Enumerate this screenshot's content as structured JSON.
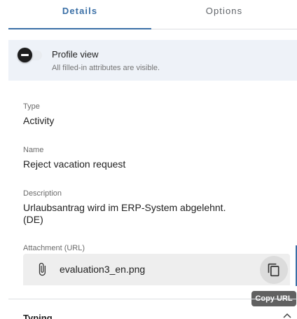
{
  "tabs": [
    {
      "label": "Details",
      "active": true
    },
    {
      "label": "Options",
      "active": false
    }
  ],
  "profile": {
    "title": "Profile view",
    "subtitle": "All filled-in attributes are visible.",
    "toggle_on": false
  },
  "fields": {
    "type": {
      "label": "Type",
      "value": "Activity"
    },
    "name": {
      "label": "Name",
      "value": "Reject vacation request"
    },
    "description": {
      "label": "Description",
      "line1": "Urlaubsantrag wird im ERP-System abgelehnt.",
      "line2": "(DE)"
    },
    "attachment": {
      "label": "Attachment (URL)",
      "value": "evaluation3_en.png"
    }
  },
  "tooltip": {
    "text": "Copy URL"
  },
  "section": {
    "title": "Typing"
  },
  "icons": {
    "attachment": "paperclip-icon",
    "copy": "copy-icon",
    "section": "chevron-up-icon",
    "toggle": "toggle-switch"
  },
  "colors": {
    "accent": "#3a6fa6",
    "banner": "#eef2f8",
    "tooltip": "#616161"
  }
}
